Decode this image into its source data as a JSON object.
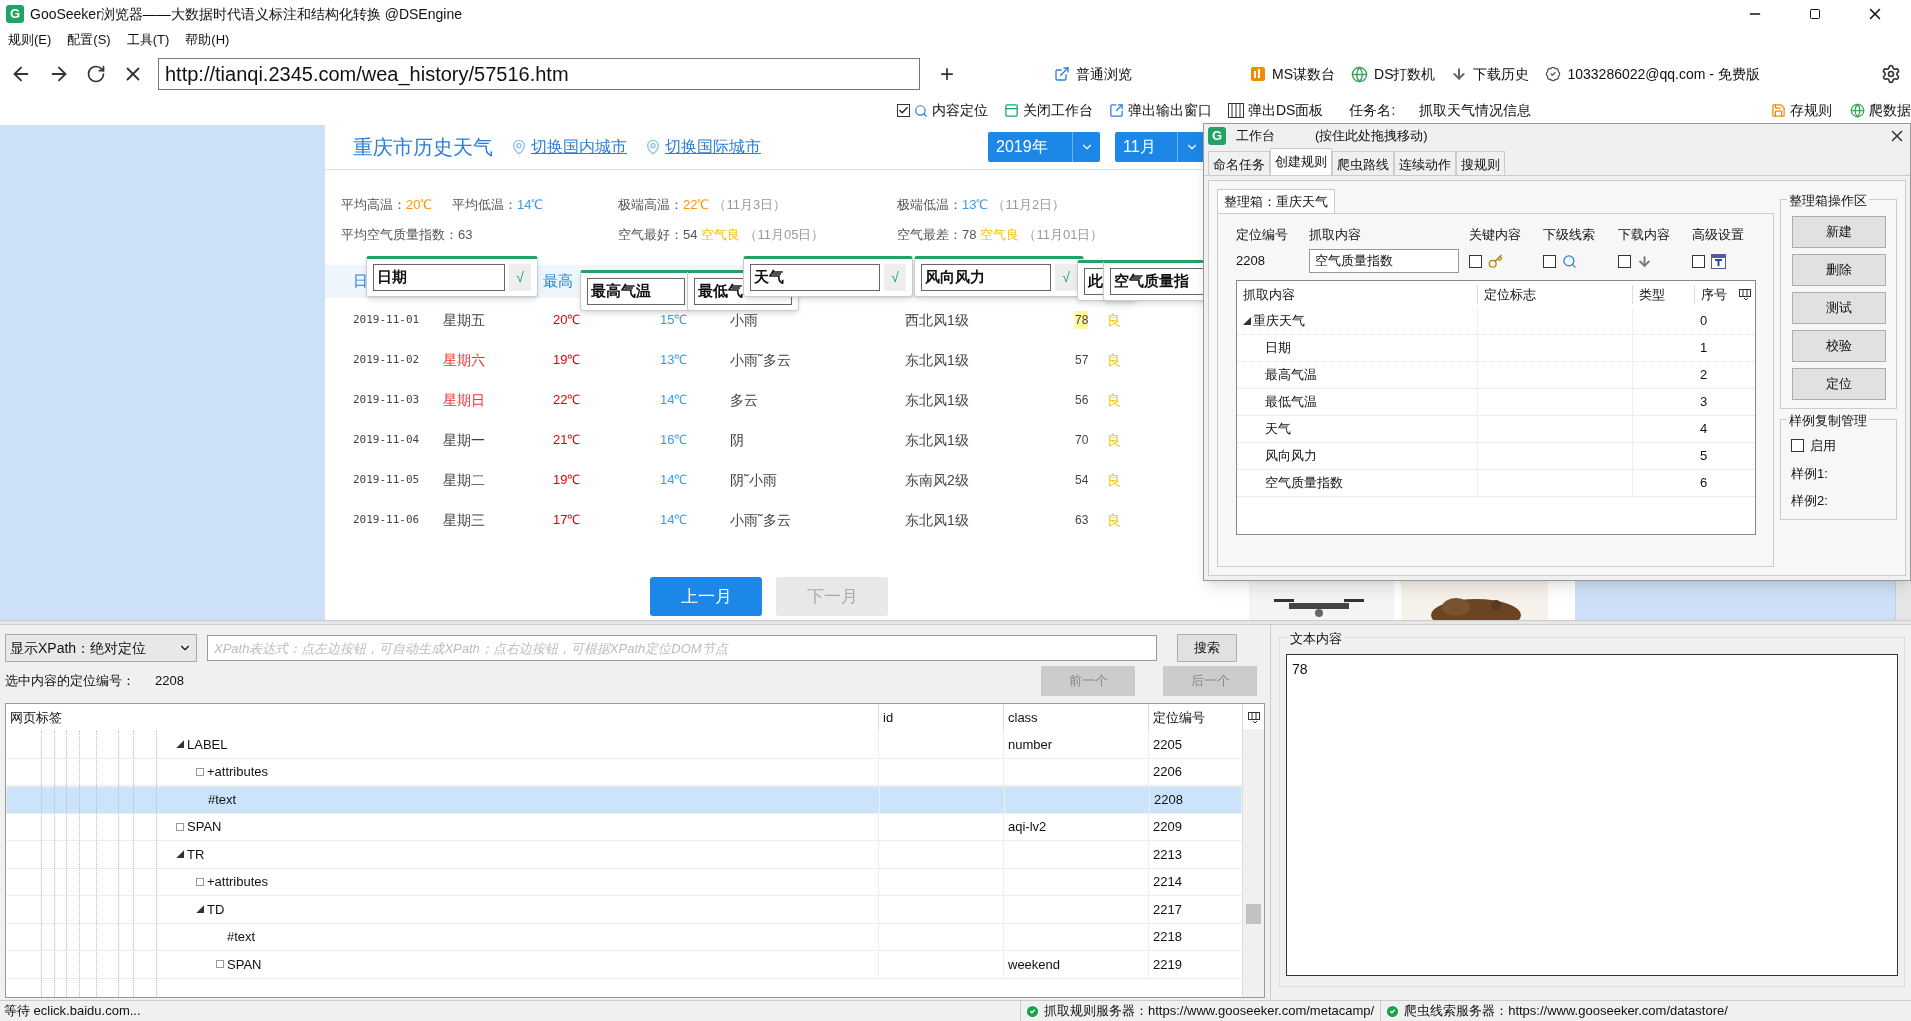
{
  "window": {
    "logo": "G",
    "title": "GooSeeker浏览器——大数据时代语义标注和结构化转换 @DSEngine"
  },
  "menu": [
    "规则(E)",
    "配置(S)",
    "工具(T)",
    "帮助(H)"
  ],
  "address_bar": {
    "url": "http://tianqi.2345.com/wea_history/57516.htm",
    "new_tab": "+"
  },
  "toolbar": [
    {
      "kind": "browse",
      "label": "普通浏览"
    },
    {
      "kind": "ms",
      "label": "MS谋数台"
    },
    {
      "kind": "ds",
      "label": "DS打数机"
    },
    {
      "kind": "download",
      "label": "下载历史"
    },
    {
      "kind": "account",
      "label": "1033286022@qq.com - 免费版"
    }
  ],
  "workbench_bar": {
    "items": [
      {
        "kind": "checkbox",
        "label": "内容定位",
        "checked": true
      },
      {
        "kind": "close",
        "label": "关闭工作台"
      },
      {
        "kind": "output",
        "label": "弹出输出窗口"
      },
      {
        "kind": "panel",
        "label": "弹出DS面板"
      }
    ],
    "task_label": "任务名:",
    "task_name": "抓取天气情况信息",
    "actions": [
      {
        "kind": "save",
        "label": "存规则"
      },
      {
        "kind": "crawl",
        "label": "爬数据"
      }
    ]
  },
  "web_page": {
    "title": "重庆市历史天气",
    "links": [
      "切换国内城市",
      "切换国际城市"
    ],
    "year": "2019年",
    "month": "11月",
    "stats": [
      [
        {
          "label": "平均高温：",
          "value": "20℃",
          "kind": "warm"
        },
        {
          "label": "平均低温：",
          "value": "14℃",
          "kind": "cool"
        },
        {
          "label": "极端高温：",
          "value": "22℃",
          "kind": "warm",
          "note": "（11月3日）"
        },
        {
          "label": "极端低温：",
          "value": "13℃",
          "kind": "cool",
          "note": "（11月2日）"
        }
      ],
      [
        {
          "label": "平均空气质量指数：",
          "value": "63",
          "kind": "plain"
        },
        {
          "label": "空气最好：",
          "value": "54",
          "kind": "plain",
          "quality": "空气良",
          "note": "（11月05日）"
        },
        {
          "label": "空气最差：",
          "value": "78",
          "kind": "plain",
          "quality": "空气良",
          "note": "（11月01日）"
        }
      ]
    ],
    "table": {
      "header": [
        "日",
        "最高"
      ],
      "rows": [
        {
          "date": "2019-11-01",
          "weekday": "星期五",
          "weekend": false,
          "high": "20℃",
          "low": "15℃",
          "weather": "小雨",
          "wind": "西北风1级",
          "aqi": "78",
          "level": "良",
          "highlighted": true
        },
        {
          "date": "2019-11-02",
          "weekday": "星期六",
          "weekend": true,
          "high": "19℃",
          "low": "13℃",
          "weather": "小雨˜多云",
          "wind": "东北风1级",
          "aqi": "57",
          "level": "良",
          "highlighted": false
        },
        {
          "date": "2019-11-03",
          "weekday": "星期日",
          "weekend": true,
          "high": "22℃",
          "low": "14℃",
          "weather": "多云",
          "wind": "东北风1级",
          "aqi": "56",
          "level": "良",
          "highlighted": false
        },
        {
          "date": "2019-11-04",
          "weekday": "星期一",
          "weekend": false,
          "high": "21℃",
          "low": "16℃",
          "weather": "阴",
          "wind": "东北风1级",
          "aqi": "70",
          "level": "良",
          "highlighted": false
        },
        {
          "date": "2019-11-05",
          "weekday": "星期二",
          "weekend": false,
          "high": "19℃",
          "low": "14℃",
          "weather": "阴˜小雨",
          "wind": "东南风2级",
          "aqi": "54",
          "level": "良",
          "highlighted": false
        },
        {
          "date": "2019-11-06",
          "weekday": "星期三",
          "weekend": false,
          "high": "17℃",
          "low": "14℃",
          "weather": "小雨˜多云",
          "wind": "东北风1级",
          "aqi": "63",
          "level": "良",
          "highlighted": false
        }
      ]
    },
    "popups": [
      {
        "label": "日期",
        "confirm": "√"
      },
      {
        "label": "最高气温"
      },
      {
        "label": "最低气"
      },
      {
        "label": "天气",
        "confirm": "√"
      },
      {
        "label": "风向风力",
        "confirm": "√"
      },
      {
        "label": "此"
      },
      {
        "label": "空气质量指"
      }
    ],
    "pager": [
      {
        "label": "上一月",
        "disabled": false
      },
      {
        "label": "下一月",
        "disabled": true
      }
    ]
  },
  "workbench": {
    "logo": "G",
    "title": "工作台",
    "hint": "(按住此处拖拽移动)",
    "tabs": [
      {
        "label": "命名任务",
        "selected": false
      },
      {
        "label": "创建规则",
        "selected": true
      },
      {
        "label": "爬虫路线",
        "selected": false
      },
      {
        "label": "连续动作",
        "selected": false
      },
      {
        "label": "搜规则",
        "selected": false
      }
    ],
    "box_tab": "整理箱：重庆天气",
    "id_label": "定位编号",
    "id": "2208",
    "content_label": "抓取内容",
    "content": "空气质量指数",
    "options": [
      {
        "kind": "key",
        "label": "关键内容",
        "checked": false
      },
      {
        "kind": "clue",
        "label": "下级线索",
        "checked": false
      },
      {
        "kind": "download",
        "label": "下载内容",
        "checked": false
      },
      {
        "kind": "advanced",
        "label": "高级设置",
        "checked": false
      }
    ],
    "grid": {
      "columns": [
        "抓取内容",
        "定位标志",
        "类型",
        "序号"
      ],
      "rows": [
        {
          "name": "重庆天气",
          "index": "0",
          "expanded": true,
          "children": [
            {
              "name": "日期",
              "index": "1"
            },
            {
              "name": "最高气温",
              "index": "2"
            },
            {
              "name": "最低气温",
              "index": "3"
            },
            {
              "name": "天气",
              "index": "4"
            },
            {
              "name": "风向风力",
              "index": "5"
            },
            {
              "name": "空气质量指数",
              "index": "6"
            }
          ]
        }
      ]
    },
    "ops": {
      "title": "整理箱操作区",
      "buttons": [
        "新建",
        "删除",
        "测试",
        "校验",
        "定位"
      ]
    },
    "samples": {
      "title": "样例复制管理",
      "enable": {
        "label": "启用",
        "checked": false
      },
      "lines": [
        "样例1:",
        "样例2:"
      ]
    }
  },
  "inspector": {
    "xpath_mode": "显示XPath：绝对定位",
    "xpath_placeholder": "XPath表达式：点左边按钮，可自动生成XPath；点右边按钮，可根据XPath定位DOM节点",
    "search": "搜索",
    "selected_label": "选中内容的定位编号：",
    "selected_value": "2208",
    "nav": [
      {
        "label": "前一个",
        "disabled": true
      },
      {
        "label": "后一个",
        "disabled": true
      }
    ],
    "columns": [
      "网页标签",
      "id",
      "class",
      "定位编号"
    ],
    "nodes": [
      {
        "tag": "LABEL",
        "class": "number",
        "code": "2205",
        "expanded": true,
        "selected": false,
        "children": [
          {
            "tag": "+attributes",
            "code": "2206",
            "expanded": false,
            "selected": false
          },
          {
            "tag": "#text",
            "code": "2208",
            "selected": true
          }
        ]
      },
      {
        "tag": "SPAN",
        "class": "aqi-lv2",
        "code": "2209",
        "expanded": false,
        "selected": false
      },
      {
        "tag": "TR",
        "code": "2213",
        "expanded": true,
        "selected": false,
        "children": [
          {
            "tag": "+attributes",
            "code": "2214",
            "expanded": false,
            "selected": false
          },
          {
            "tag": "TD",
            "code": "2217",
            "expanded": true,
            "selected": false,
            "children": [
              {
                "tag": "#text",
                "code": "2218",
                "selected": false
              },
              {
                "tag": "SPAN",
                "class": "weekend",
                "code": "2219",
                "expanded": false,
                "selected": false
              }
            ]
          }
        ]
      }
    ]
  },
  "text_panel": {
    "title": "文本内容",
    "value": "78"
  },
  "status_bar": {
    "message": "等待 eclick.baidu.com...",
    "servers": [
      {
        "label": "抓取规则服务器：https://www.gooseeker.com/metacamp/",
        "ok": true
      },
      {
        "label": "爬虫线索服务器：https://www.gooseeker.com/datastore/",
        "ok": true
      }
    ]
  }
}
